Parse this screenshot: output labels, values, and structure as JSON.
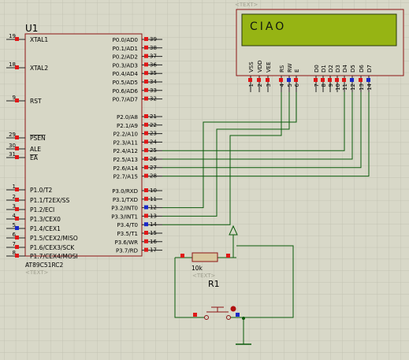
{
  "colors": {
    "background": "#d8d8c8",
    "grid": "#c2c2b2",
    "chip_fill": "#d7d7c6",
    "chip_border": "#8c1414",
    "wire": "#0a5a0a",
    "pin_red": "#e01818",
    "pin_blue": "#1a28c8",
    "lcd_screen": "#96b414",
    "lcd_text": "#101810",
    "text_placeholder": "#a0a090"
  },
  "mcu": {
    "ref": "U1",
    "part": "AT89C51RC2",
    "text_placeholder": "<TEXT>",
    "left_pins": [
      {
        "num": "19",
        "label": "XTAL1"
      },
      {
        "num": "18",
        "label": "XTAL2"
      },
      {
        "num": "9",
        "label": "RST"
      },
      {
        "num": "29",
        "label": "PSEN",
        "overline": true
      },
      {
        "num": "30",
        "label": "ALE"
      },
      {
        "num": "31",
        "label": "EA",
        "overline": true
      },
      {
        "num": "1",
        "label": "P1.0/T2"
      },
      {
        "num": "2",
        "label": "P1.1/T2EX/SS"
      },
      {
        "num": "3",
        "label": "P1.2/ECI"
      },
      {
        "num": "4",
        "label": "P1.3/CEX0"
      },
      {
        "num": "5",
        "label": "P1.4/CEX1"
      },
      {
        "num": "6",
        "label": "P1.5/CEX2/MISO"
      },
      {
        "num": "7",
        "label": "P1.6/CEX3/SCK"
      },
      {
        "num": "8",
        "label": "P1.7/CEX4/MOSI"
      }
    ],
    "right_pins": [
      {
        "num": "39",
        "label": "P0.0/AD0"
      },
      {
        "num": "38",
        "label": "P0.1/AD1"
      },
      {
        "num": "37",
        "label": "P0.2/AD2"
      },
      {
        "num": "36",
        "label": "P0.3/AD3"
      },
      {
        "num": "35",
        "label": "P0.4/AD4"
      },
      {
        "num": "34",
        "label": "P0.5/AD5"
      },
      {
        "num": "33",
        "label": "P0.6/AD6"
      },
      {
        "num": "32",
        "label": "P0.7/AD7"
      },
      {
        "num": "21",
        "label": "P2.0/A8"
      },
      {
        "num": "22",
        "label": "P2.1/A9"
      },
      {
        "num": "23",
        "label": "P2.2/A10"
      },
      {
        "num": "24",
        "label": "P2.3/A11"
      },
      {
        "num": "25",
        "label": "P2.4/A12"
      },
      {
        "num": "26",
        "label": "P2.5/A13"
      },
      {
        "num": "27",
        "label": "P2.6/A14"
      },
      {
        "num": "28",
        "label": "P2.7/A15"
      },
      {
        "num": "10",
        "label": "P3.0/RXD"
      },
      {
        "num": "11",
        "label": "P3.1/TXD"
      },
      {
        "num": "12",
        "label": "P3.2/INT0"
      },
      {
        "num": "13",
        "label": "P3.3/INT1"
      },
      {
        "num": "14",
        "label": "P3.4/T0"
      },
      {
        "num": "15",
        "label": "P3.5/T1"
      },
      {
        "num": "16",
        "label": "P3.6/WR"
      },
      {
        "num": "17",
        "label": "P3.7/RD"
      }
    ]
  },
  "lcd": {
    "text_placeholder": "<TEXT>",
    "display_text": "CIAO",
    "pins": [
      {
        "name": "VSS",
        "num": "1"
      },
      {
        "name": "VDD",
        "num": "2"
      },
      {
        "name": "VEE",
        "num": "3"
      },
      {
        "name": "RS",
        "num": "4"
      },
      {
        "name": "RW",
        "num": "5"
      },
      {
        "name": "E",
        "num": "6"
      },
      {
        "name": "D0",
        "num": "7"
      },
      {
        "name": "D1",
        "num": "8"
      },
      {
        "name": "D2",
        "num": "9"
      },
      {
        "name": "D3",
        "num": "10"
      },
      {
        "name": "D4",
        "num": "11"
      },
      {
        "name": "D5",
        "num": "12"
      },
      {
        "name": "D6",
        "num": "13"
      },
      {
        "name": "D7",
        "num": "14"
      }
    ]
  },
  "resistor": {
    "ref": "R1",
    "value": "10k",
    "text_placeholder": "<TEXT>"
  },
  "icons": {
    "power": "power-terminal-icon",
    "ground": "ground-terminal-icon",
    "button": "push-button-icon"
  }
}
